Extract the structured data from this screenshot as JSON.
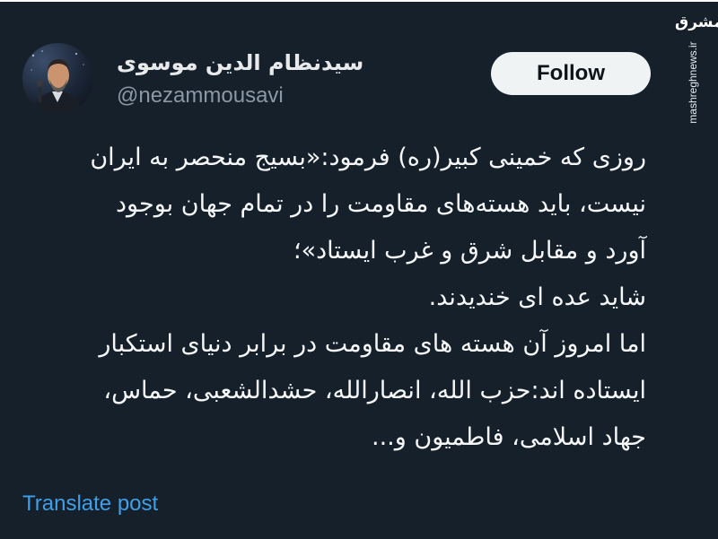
{
  "author": {
    "display_name": "سیدنظام الدین موسوی",
    "handle": "@nezammousavi"
  },
  "follow_button": {
    "label": "Follow"
  },
  "tweet": {
    "lines": [
      "روزی که خمینی کبیر(ره) فرمود:«بسیج منحصر به ایران",
      "نیست، باید هسته‌های مقاومت را در تمام جهان بوجود",
      "آورد و مقابل شرق و غرب ایستاد»؛",
      "شاید عده ای خندیدند.",
      "اما امروز آن هسته های مقاومت در برابر دنیای استکبار",
      "ایستاده اند:حزب الله، انصارالله، حشدالشعبی، حماس،",
      "جهاد اسلامی، فاطمیون و..."
    ]
  },
  "translate": {
    "label": "Translate post"
  },
  "watermark": {
    "logo_text": "مشرق",
    "url": "mashreghnews.ir"
  },
  "colors": {
    "background": "#15202b",
    "link": "#3f9fe8",
    "follow_bg": "#eff3f4",
    "secondary_text": "#8b98a5"
  }
}
